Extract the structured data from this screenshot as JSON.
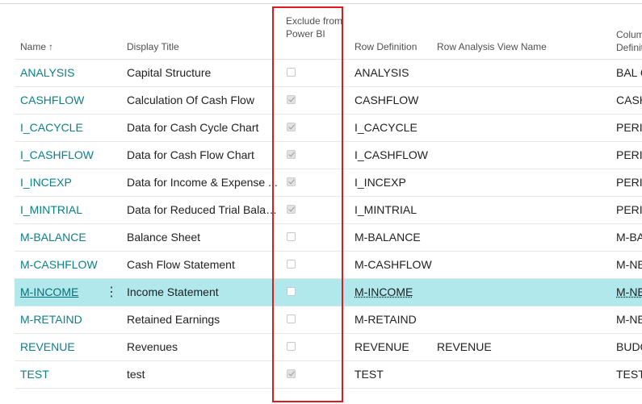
{
  "columns": {
    "name": "Name",
    "name_sort_icon": "sort-ascending-arrow",
    "display_title": "Display Title",
    "exclude_from_power_bi": "Exclude from Power BI",
    "row_definition": "Row Definition",
    "row_analysis_view_name": "Row Analysis View Name",
    "column_definition": "Colum\nDefinit"
  },
  "rows": [
    {
      "name": "ANALYSIS",
      "title": "Capital Structure",
      "exclude": false,
      "row_def": "ANALYSIS",
      "rav": "",
      "col_def": "BAL C"
    },
    {
      "name": "CASHFLOW",
      "title": "Calculation Of Cash Flow",
      "exclude": true,
      "row_def": "CASHFLOW",
      "rav": "",
      "col_def": "CASH"
    },
    {
      "name": "I_CACYCLE",
      "title": "Data for Cash Cycle Chart",
      "exclude": true,
      "row_def": "I_CACYCLE",
      "rav": "",
      "col_def": "PERIC"
    },
    {
      "name": "I_CASHFLOW",
      "title": "Data for Cash Flow Chart",
      "exclude": true,
      "row_def": "I_CASHFLOW",
      "rav": "",
      "col_def": "PERIC"
    },
    {
      "name": "I_INCEXP",
      "title": "Data for Income & Expense ...",
      "exclude": true,
      "row_def": "I_INCEXP",
      "rav": "",
      "col_def": "PERIC"
    },
    {
      "name": "I_MINTRIAL",
      "title": "Data for Reduced Trial Balanc...",
      "exclude": true,
      "row_def": "I_MINTRIAL",
      "rav": "",
      "col_def": "PERIC"
    },
    {
      "name": "M-BALANCE",
      "title": "Balance Sheet",
      "exclude": false,
      "row_def": "M-BALANCE",
      "rav": "",
      "col_def": "M-BA"
    },
    {
      "name": "M-CASHFLOW",
      "title": "Cash Flow Statement",
      "exclude": false,
      "row_def": "M-CASHFLOW",
      "rav": "",
      "col_def": "M-NE"
    },
    {
      "name": "M-INCOME",
      "title": "Income Statement",
      "exclude": false,
      "row_def": "M-INCOME",
      "rav": "",
      "col_def": "M-NE",
      "selected": true
    },
    {
      "name": "M-RETAIND",
      "title": "Retained Earnings",
      "exclude": false,
      "row_def": "M-RETAIND",
      "rav": "",
      "col_def": "M-NE"
    },
    {
      "name": "REVENUE",
      "title": "Revenues",
      "exclude": false,
      "row_def": "REVENUE",
      "rav": "REVENUE",
      "col_def": "BUDG"
    },
    {
      "name": "TEST",
      "title": "test",
      "exclude": true,
      "row_def": "TEST",
      "rav": "",
      "col_def": "TEST"
    }
  ],
  "row_menu_icon": "vertical-ellipsis-icon",
  "row_menu_glyph": "⋮",
  "colors": {
    "accent": "#0a7f8a",
    "selected_row": "#b0e8ec",
    "highlight_box": "#e0191f"
  }
}
